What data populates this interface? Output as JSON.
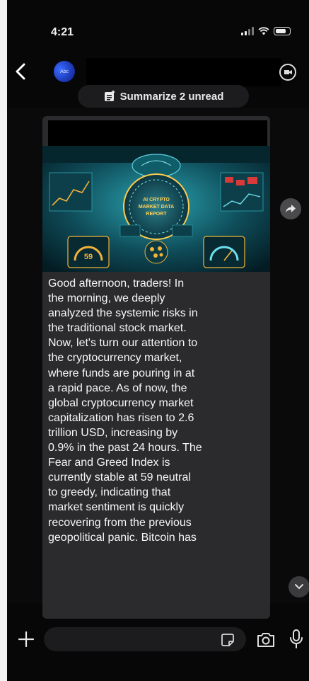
{
  "status_bar": {
    "time": "4:21"
  },
  "header": {
    "avatar_text": "Abc"
  },
  "summarize": {
    "label": "Summarize 2 unread"
  },
  "media": {
    "title_lines": [
      "AI CRYPTO",
      "MARKET DATA",
      "REPORT"
    ],
    "gauge_value": "59"
  },
  "message": {
    "text": "Good afternoon, traders! In\nthe morning, we deeply\nanalyzed the systemic risks in\nthe traditional stock market.\nNow, let's turn our attention to\nthe cryptocurrency market,\nwhere funds are pouring in at\na rapid pace. As of now, the\nglobal cryptocurrency market\ncapitalization has risen to 2.6\ntrillion USD, increasing by\n0.9% in the past 24 hours. The\nFear and Greed Index is\ncurrently stable at 59 neutral\nto greedy, indicating that\nmarket sentiment is quickly\nrecovering from the previous\ngeopolitical panic. Bitcoin  has"
  },
  "composer": {
    "placeholder": ""
  },
  "colors": {
    "background": "#070707",
    "bubble": "#2b2b2d",
    "pill": "#1c1c1e",
    "media_teal": "#1d6f7c"
  }
}
